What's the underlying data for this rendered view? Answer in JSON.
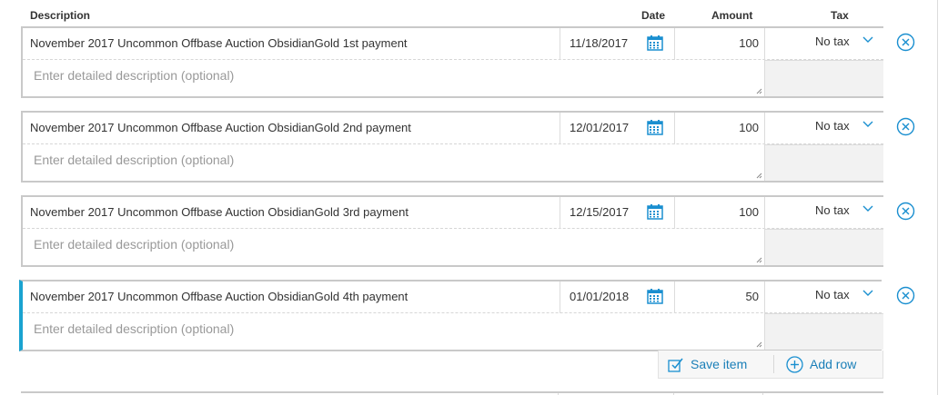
{
  "header": {
    "description": "Description",
    "date": "Date",
    "amount": "Amount",
    "tax": "Tax"
  },
  "rows": [
    {
      "description": "November 2017 Uncommon Offbase Auction ObsidianGold 1st payment",
      "date": "11/18/2017",
      "amount": "100",
      "tax": "No tax",
      "detail_placeholder": "Enter detailed description (optional)"
    },
    {
      "description": "November 2017 Uncommon Offbase Auction ObsidianGold 2nd payment",
      "date": "12/01/2017",
      "amount": "100",
      "tax": "No tax",
      "detail_placeholder": "Enter detailed description (optional)"
    },
    {
      "description": "November 2017 Uncommon Offbase Auction ObsidianGold 3rd payment",
      "date": "12/15/2017",
      "amount": "100",
      "tax": "No tax",
      "detail_placeholder": "Enter detailed description (optional)"
    },
    {
      "description": "November 2017 Uncommon Offbase Auction ObsidianGold 4th payment",
      "date": "01/01/2018",
      "amount": "50",
      "tax": "No tax",
      "detail_placeholder": "Enter detailed description (optional)"
    }
  ],
  "actions": {
    "save_label": "Save item",
    "add_label": "Add row"
  },
  "icons": {
    "calendar": "calendar-icon",
    "chevron": "chevron-down-icon",
    "remove": "remove-circle-icon",
    "save": "save-item-icon",
    "add": "add-row-icon"
  },
  "colors": {
    "accent": "#1aa3d0",
    "link": "#1a7fb8",
    "border": "#c9c9c9",
    "placeholder": "#999999"
  }
}
